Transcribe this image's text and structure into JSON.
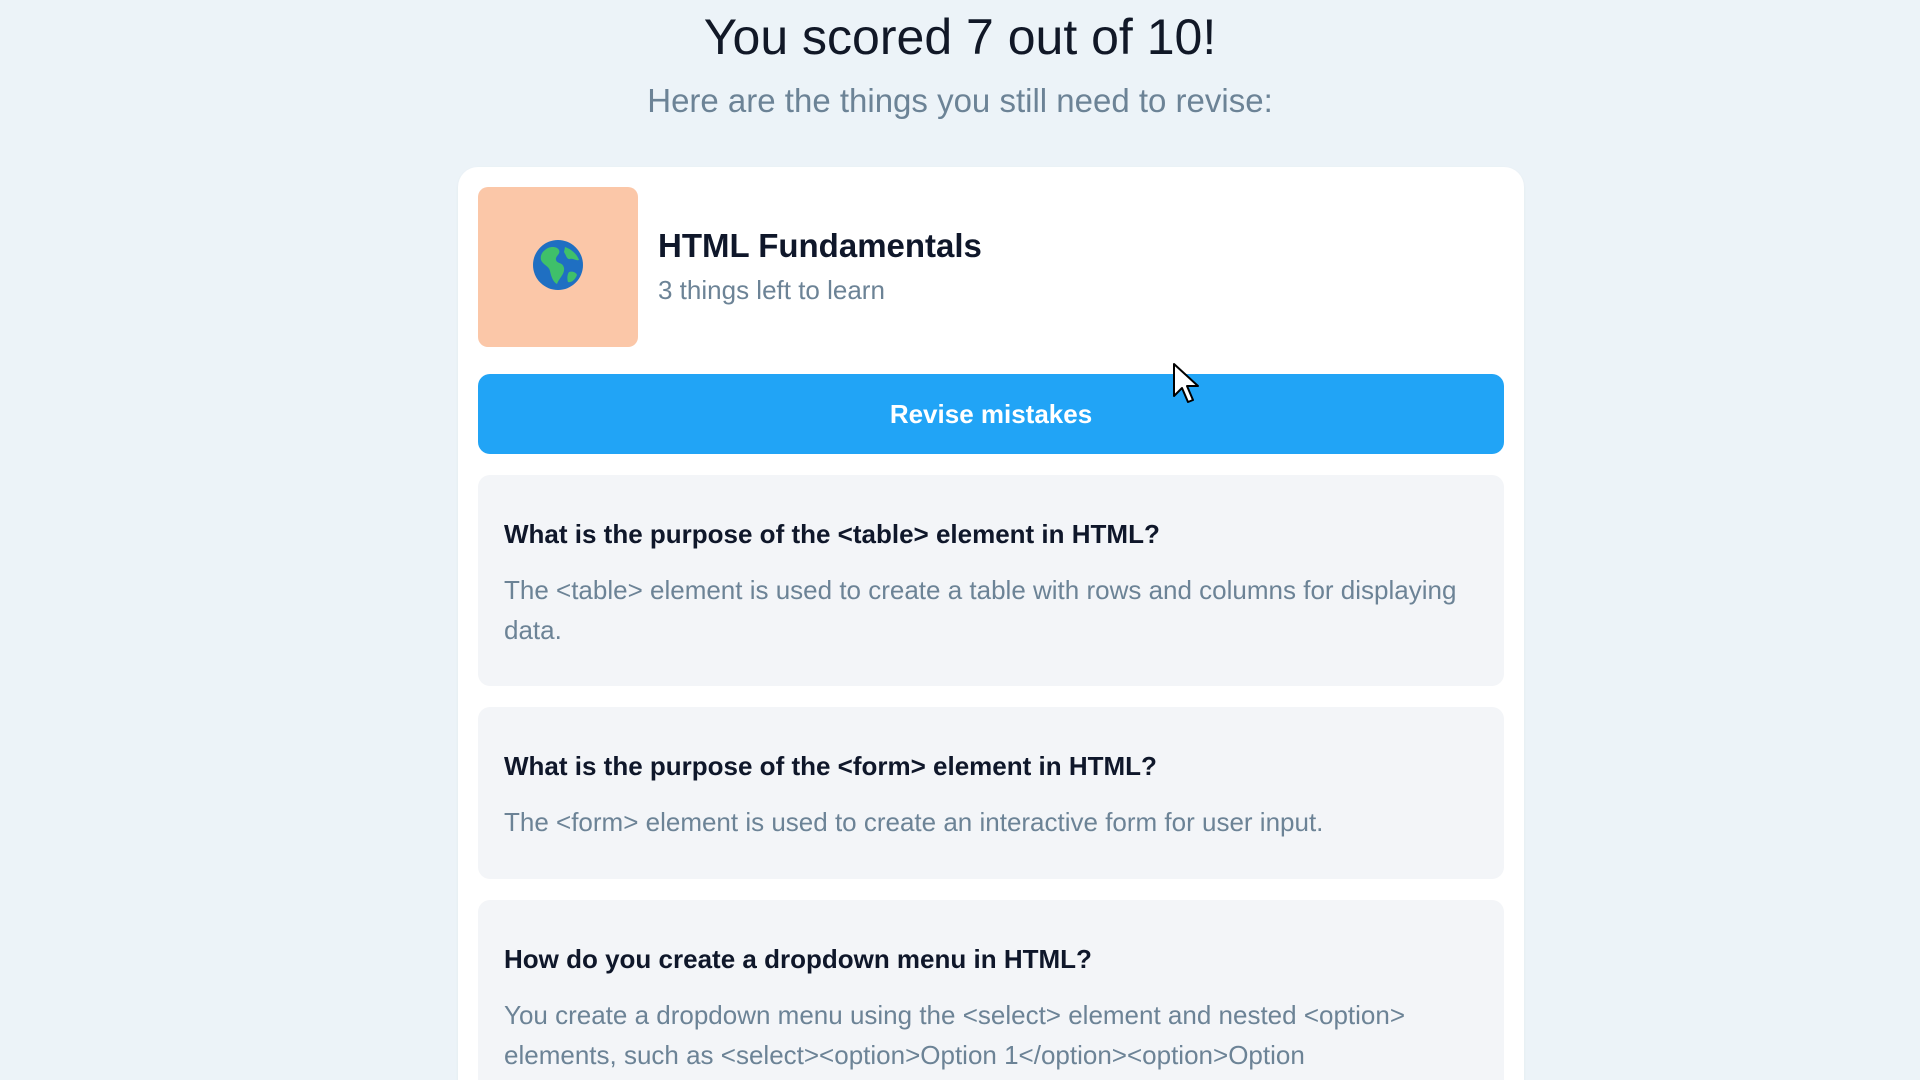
{
  "header": {
    "score_title": "You scored 7 out of 10!",
    "subtitle": "Here are the things you still need to revise:"
  },
  "course": {
    "icon": "globe-icon",
    "title": "HTML Fundamentals",
    "remaining": "3 things left to learn",
    "thumb_color": "#fbc7a8"
  },
  "actions": {
    "revise_label": "Revise mistakes",
    "accent": "#21a4f6"
  },
  "questions": [
    {
      "question": "What is the purpose of the <table> element in HTML?",
      "answer": "The <table> element is used to create a table with rows and columns for displaying data."
    },
    {
      "question": "What is the purpose of the <form> element in HTML?",
      "answer": "The <form> element is used to create an interactive form for user input."
    },
    {
      "question": "How do you create a dropdown menu in HTML?",
      "answer": "You create a dropdown menu using the <select> element and nested <option> elements, such as <select><option>Option 1</option><option>Option"
    }
  ]
}
